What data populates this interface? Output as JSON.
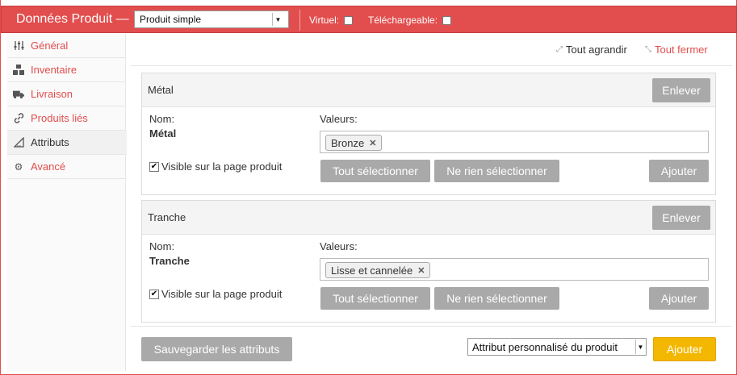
{
  "header": {
    "title": "Données Produit —",
    "product_type": "Produit simple",
    "virtual_label": "Virtuel:",
    "downloadable_label": "Téléchargeable:"
  },
  "sidebar": {
    "items": [
      {
        "label": "Général",
        "icon": "sliders-icon"
      },
      {
        "label": "Inventaire",
        "icon": "boxes-icon"
      },
      {
        "label": "Livraison",
        "icon": "truck-icon"
      },
      {
        "label": "Produits liés",
        "icon": "link-icon"
      },
      {
        "label": "Attributs",
        "icon": "ruler-triangle-icon"
      },
      {
        "label": "Avancé",
        "icon": "gear-icon"
      }
    ]
  },
  "toolbar": {
    "expand_all": "Tout agrandir",
    "close_all": "Tout fermer"
  },
  "attributes": [
    {
      "title": "Métal",
      "remove_label": "Enlever",
      "name_label": "Nom:",
      "name_value": "Métal",
      "values_label": "Valeurs:",
      "value_chip": "Bronze",
      "visible_label": "Visible sur la page produit",
      "select_all": "Tout sélectionner",
      "select_none": "Ne rien sélectionner",
      "add_label": "Ajouter"
    },
    {
      "title": "Tranche",
      "remove_label": "Enlever",
      "name_label": "Nom:",
      "name_value": "Tranche",
      "values_label": "Valeurs:",
      "value_chip": "Lisse et cannelée",
      "visible_label": "Visible sur la page produit",
      "select_all": "Tout sélectionner",
      "select_none": "Ne rien sélectionner",
      "add_label": "Ajouter"
    }
  ],
  "footer": {
    "save_label": "Sauvegarder les attributs",
    "attribute_select": "Attribut personnalisé du produit",
    "add_label": "Ajouter"
  },
  "colors": {
    "accent": "#e24d4d",
    "button_gray": "#a9a9a9",
    "button_yellow": "#f4b700"
  }
}
